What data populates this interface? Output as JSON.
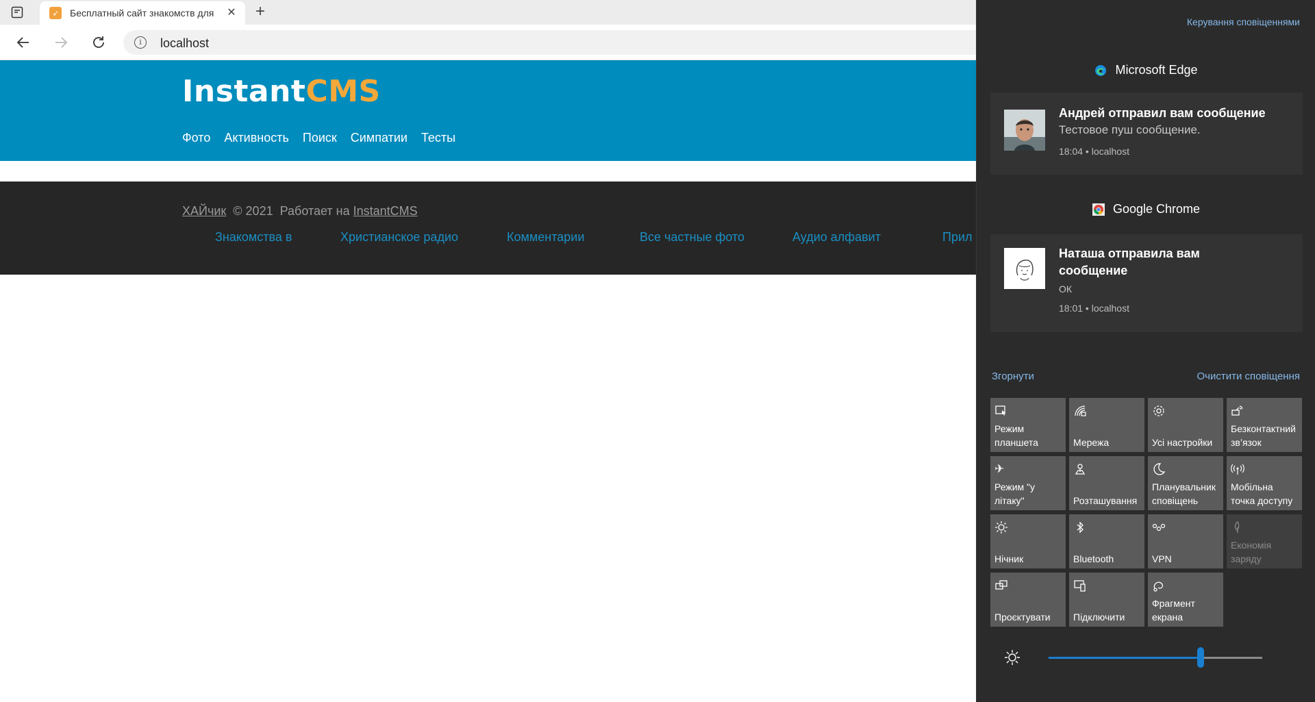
{
  "browser": {
    "tab_title": "Бесплатный сайт знакомств для",
    "address": "localhost"
  },
  "site": {
    "logo_main": "Instant",
    "logo_accent": "CMS",
    "logo_accent_color": "#f4a83a",
    "header_color": "#008cbd",
    "nav": [
      "Фото",
      "Активность",
      "Поиск",
      "Симпатии",
      "Тесты"
    ],
    "footer": {
      "owner": "ХАЙчик",
      "copyright": "© 2021",
      "powered_prefix": "Работает на",
      "powered_link": "InstantCMS",
      "links": [
        "Знакомства в",
        "Христианское радио",
        "Комментарии",
        "Все частные фото",
        "Аудио алфавит",
        "Прил"
      ]
    }
  },
  "action_center": {
    "manage_label": "Керування сповіщеннями",
    "groups": [
      {
        "app": "Microsoft Edge",
        "icon": "edge-icon",
        "notification": {
          "title": "Андрей отправил вам сообщение",
          "body": "Тестовое пуш сообщение.",
          "meta": "18:04 • localhost"
        }
      },
      {
        "app": "Google Chrome",
        "icon": "chrome-icon",
        "notification": {
          "title": "Наташа отправила вам сообщение",
          "body": "ОК",
          "meta": "18:01 • localhost"
        }
      }
    ],
    "collapse_label": "Згорнути",
    "clear_label": "Очистити сповіщення",
    "quick_actions": [
      {
        "label": "Режим планшета",
        "icon": "tablet-mode-icon",
        "enabled": true
      },
      {
        "label": "Мережа",
        "icon": "network-icon",
        "enabled": true
      },
      {
        "label": "Усі настройки",
        "icon": "settings-icon",
        "enabled": true
      },
      {
        "label": "Безконтактний зв’язок",
        "icon": "nearby-share-icon",
        "enabled": true
      },
      {
        "label": "Режим \"у літаку\"",
        "icon": "airplane-icon",
        "enabled": true
      },
      {
        "label": "Розташування",
        "icon": "location-icon",
        "enabled": true
      },
      {
        "label": "Планувальник сповіщень",
        "icon": "focus-assist-icon",
        "enabled": true
      },
      {
        "label": "Мобільна точка доступу",
        "icon": "hotspot-icon",
        "enabled": true
      },
      {
        "label": "Нічник",
        "icon": "night-light-icon",
        "enabled": true
      },
      {
        "label": "Bluetooth",
        "icon": "bluetooth-icon",
        "enabled": true
      },
      {
        "label": "VPN",
        "icon": "vpn-icon",
        "enabled": true
      },
      {
        "label": "Економія заряду",
        "icon": "battery-saver-icon",
        "enabled": false
      },
      {
        "label": "Проєктувати",
        "icon": "project-icon",
        "enabled": true
      },
      {
        "label": "Підключити",
        "icon": "connect-icon",
        "enabled": true
      },
      {
        "label": "Фрагмент екрана",
        "icon": "screen-snip-icon",
        "enabled": true
      }
    ],
    "brightness_percent": 71,
    "accent_color": "#1a7fd0"
  }
}
